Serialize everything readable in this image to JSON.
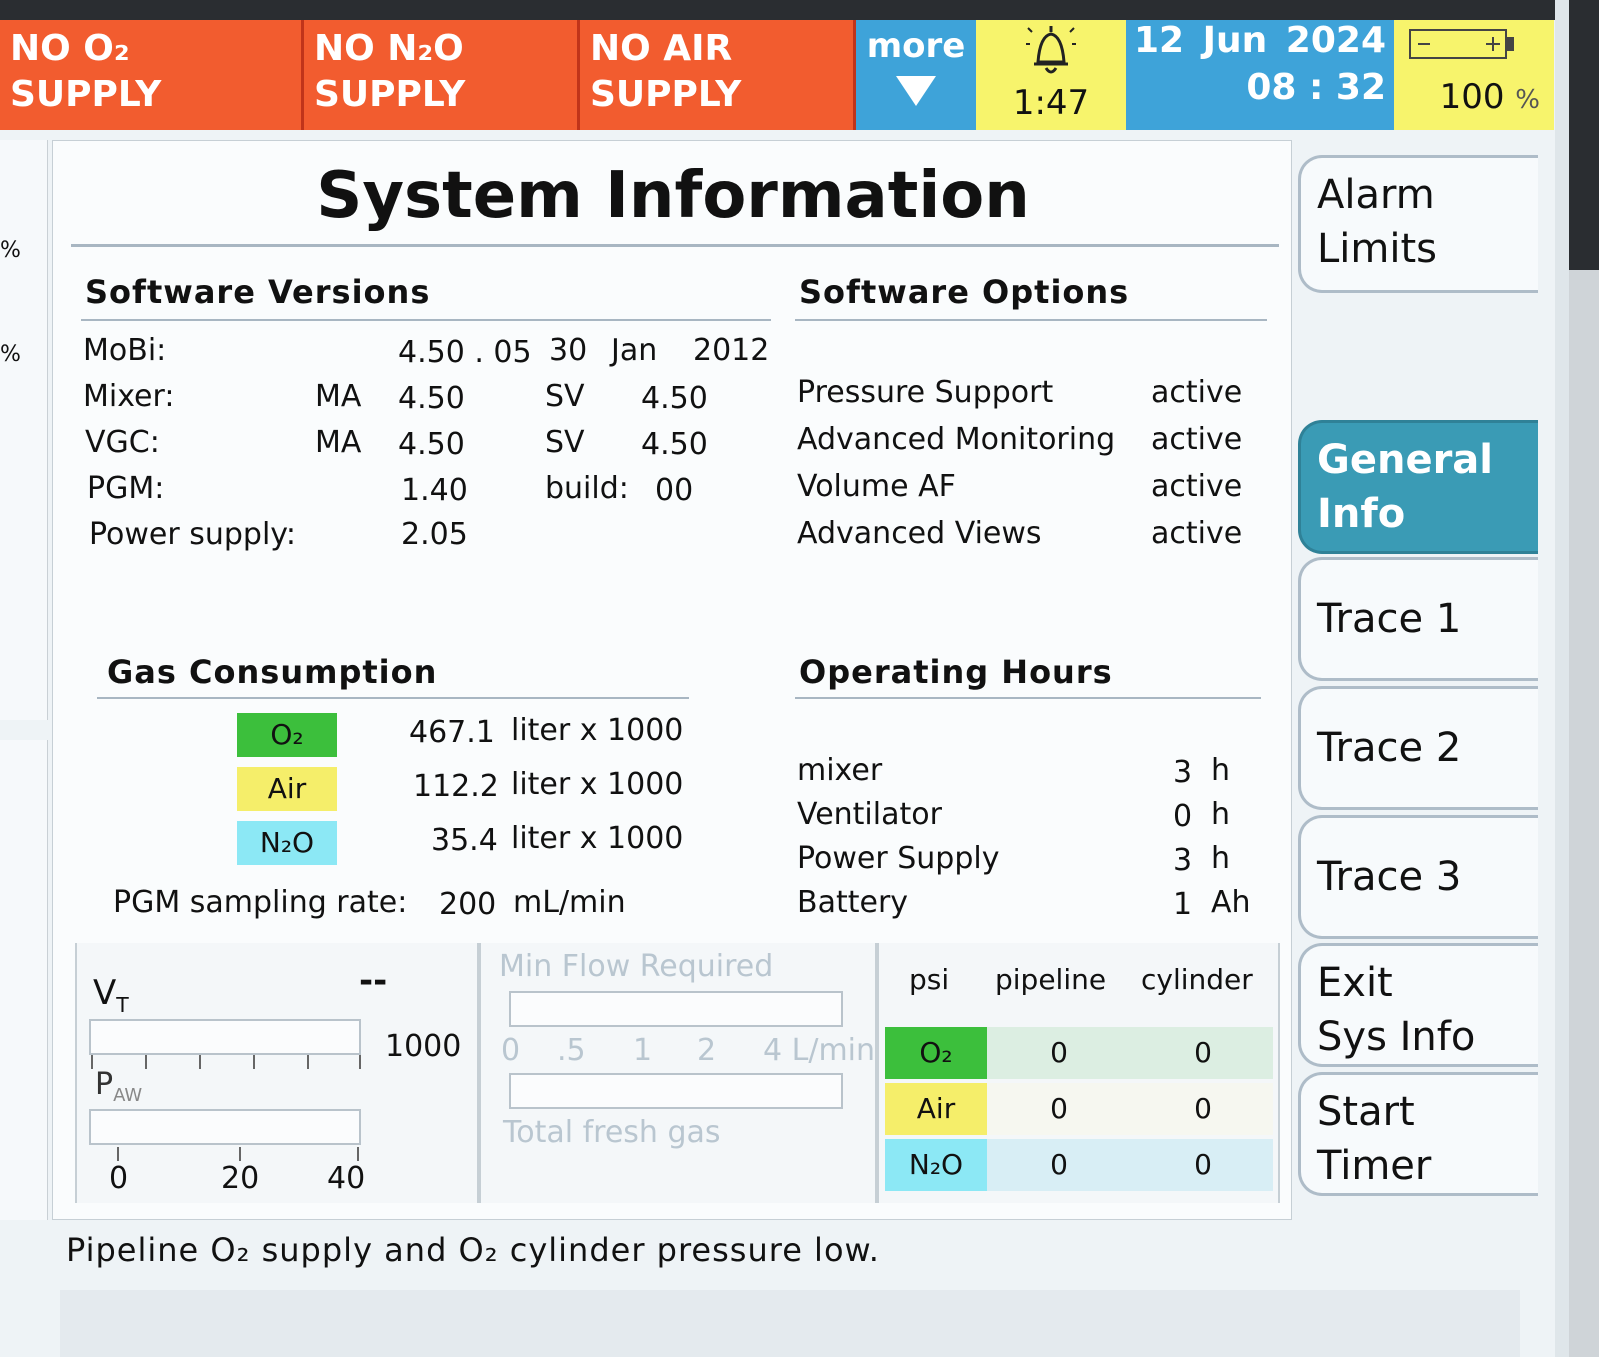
{
  "header": {
    "alarms": [
      {
        "line1": "NO O₂",
        "line2": "SUPPLY"
      },
      {
        "line1": "NO N₂O",
        "line2": "SUPPLY"
      },
      {
        "line1": "NO AIR",
        "line2": "SUPPLY"
      }
    ],
    "more_label": "more",
    "timer": "1:47",
    "date": {
      "day": "12",
      "month": "Jun",
      "year": "2024",
      "time": "08 : 32"
    },
    "battery": {
      "value": "100",
      "unit": "%"
    }
  },
  "title": "System Information",
  "software_versions": {
    "heading": "Software Versions",
    "mobi": {
      "label": "MoBi:",
      "version": "4.50 . 05",
      "day": "30",
      "month": "Jan",
      "year": "2012"
    },
    "mixer": {
      "label": "Mixer:",
      "ma": "MA",
      "ma_val": "4.50",
      "sv": "SV",
      "sv_val": "4.50"
    },
    "vgc": {
      "label": "VGC:",
      "ma": "MA",
      "ma_val": "4.50",
      "sv": "SV",
      "sv_val": "4.50"
    },
    "pgm": {
      "label": "PGM:",
      "val": "1.40",
      "build_label": "build:",
      "build_val": "00"
    },
    "power": {
      "label": "Power supply:",
      "val": "2.05"
    }
  },
  "software_options": {
    "heading": "Software Options",
    "items": [
      {
        "name": "Pressure Support",
        "state": "active"
      },
      {
        "name": "Advanced Monitoring",
        "state": "active"
      },
      {
        "name": "Volume AF",
        "state": "active"
      },
      {
        "name": "Advanced Views",
        "state": "active"
      }
    ]
  },
  "gas_consumption": {
    "heading": "Gas Consumption",
    "rows": [
      {
        "gas": "O₂",
        "value": "467.1",
        "unit": "liter x 1000",
        "color": "#3cbf3c"
      },
      {
        "gas": "Air",
        "value": "112.2",
        "unit": "liter x 1000",
        "color": "#f5ee6a"
      },
      {
        "gas": "N₂O",
        "value": "35.4",
        "unit": "liter x 1000",
        "color": "#8ce8f5"
      }
    ],
    "pgm_label": "PGM sampling rate:",
    "pgm_value": "200",
    "pgm_unit": "mL/min"
  },
  "operating_hours": {
    "heading": "Operating Hours",
    "rows": [
      {
        "name": "mixer",
        "value": "3",
        "unit": "h"
      },
      {
        "name": "Ventilator",
        "value": "0",
        "unit": "h"
      },
      {
        "name": "Power Supply",
        "value": "3",
        "unit": "h"
      },
      {
        "name": "Battery",
        "value": "1",
        "unit": "Ah"
      }
    ]
  },
  "vt_panel": {
    "vt_label": "V",
    "vt_sub": "T",
    "vt_value": "--",
    "vt_max": "1000",
    "paw_label": "P",
    "paw_sub": "AW",
    "scale": [
      "0",
      "20",
      "40"
    ]
  },
  "flow_panel": {
    "min_flow": "Min Flow Required",
    "scale": [
      "0",
      ".5",
      "1",
      "2",
      "4 L/min"
    ],
    "total": "Total fresh gas"
  },
  "pressure_table": {
    "headers": [
      "psi",
      "pipeline",
      "cylinder"
    ],
    "rows": [
      {
        "gas": "O₂",
        "pipeline": "0",
        "cylinder": "0",
        "color": "#3cbf3c",
        "bg": "#dceee2"
      },
      {
        "gas": "Air",
        "pipeline": "0",
        "cylinder": "0",
        "color": "#f5ee6a",
        "bg": "#f6f7f0"
      },
      {
        "gas": "N₂O",
        "pipeline": "0",
        "cylinder": "0",
        "color": "#8ce8f5",
        "bg": "#d8eef5"
      }
    ]
  },
  "status_message": "Pipeline O₂ supply and O₂ cylinder pressure low.",
  "sidebar": {
    "buttons": [
      {
        "line1": "Alarm",
        "line2": "Limits"
      },
      {
        "line1": "General",
        "line2": "Info"
      },
      {
        "line1": "Trace 1",
        "line2": ""
      },
      {
        "line1": "Trace 2",
        "line2": ""
      },
      {
        "line1": "Trace 3",
        "line2": ""
      },
      {
        "line1": "Exit",
        "line2": "Sys Info"
      },
      {
        "line1": "Start",
        "line2": "Timer"
      }
    ]
  },
  "left_edge": {
    "a": "%",
    "b": "%"
  }
}
